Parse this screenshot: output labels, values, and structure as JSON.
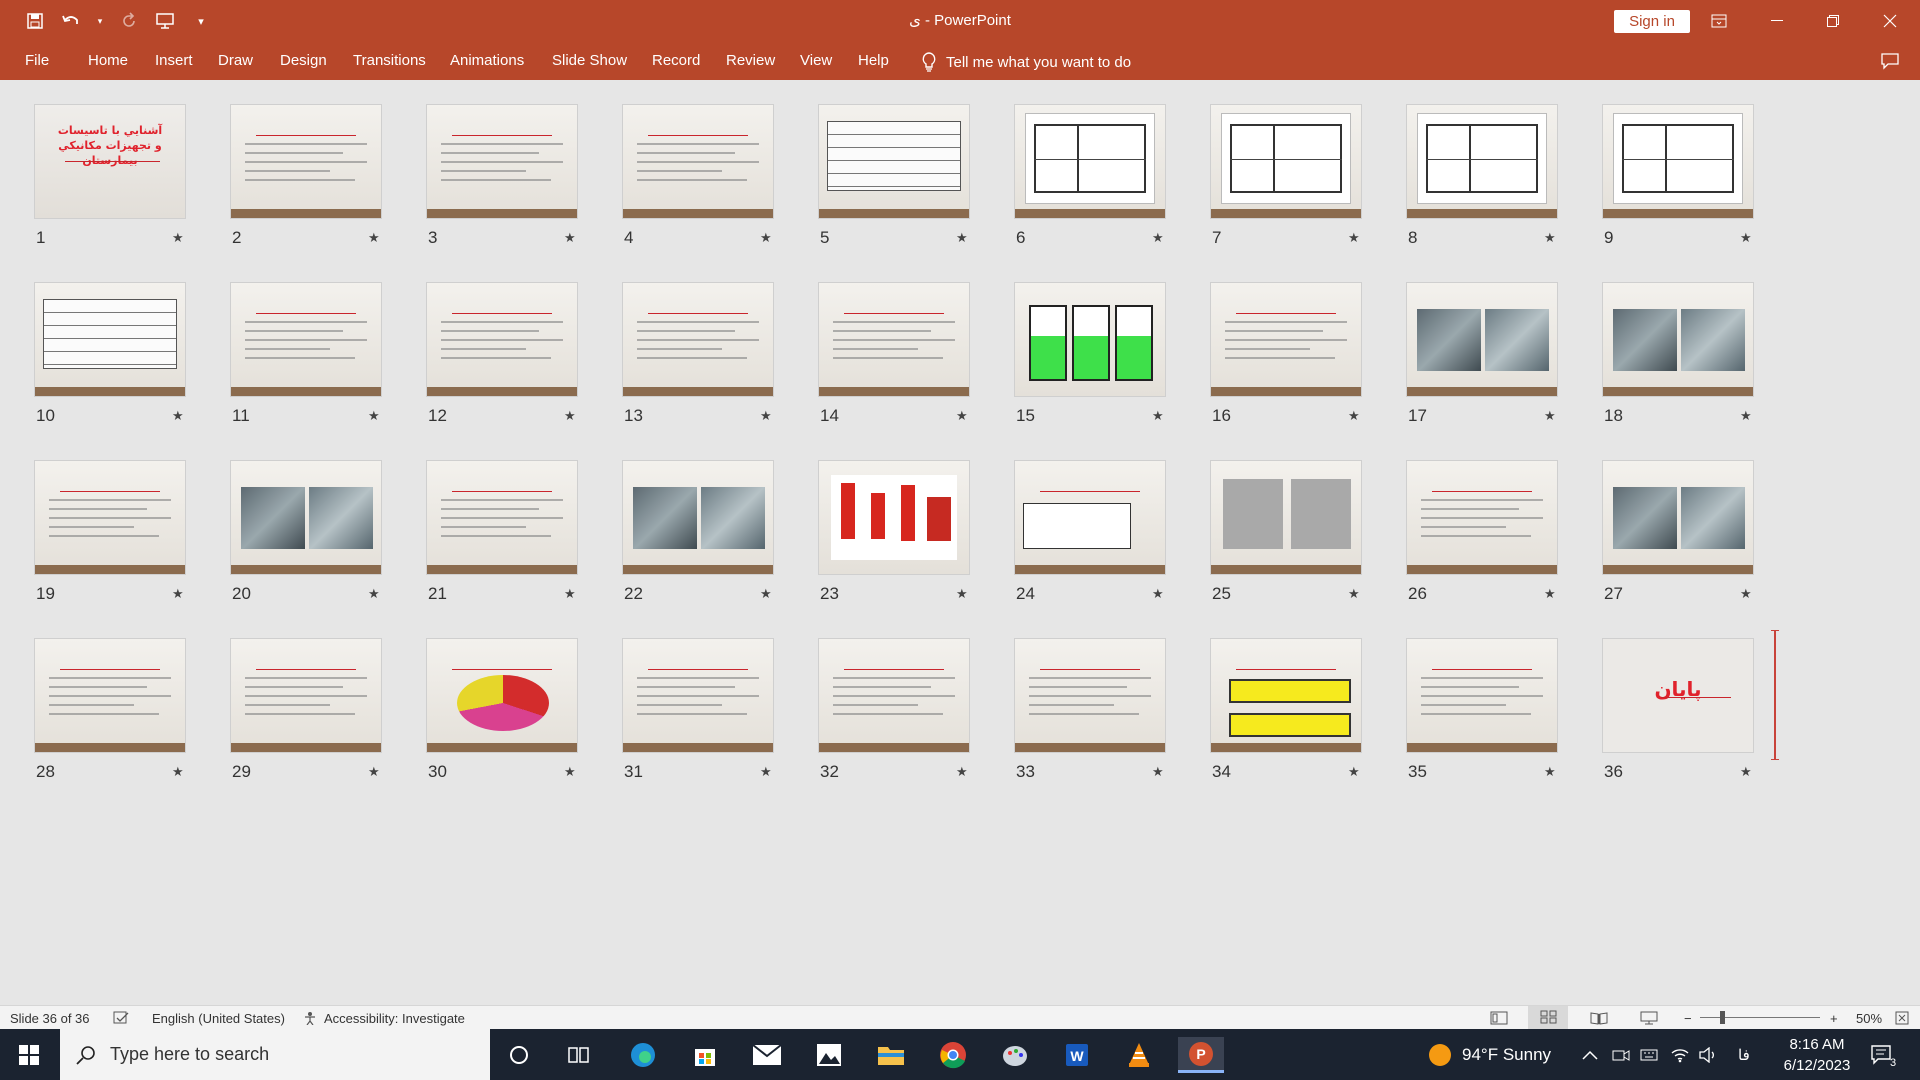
{
  "window": {
    "title": "ی  -  PowerPoint",
    "sign_in": "Sign in"
  },
  "qat": {
    "icons": [
      "save-icon",
      "undo-icon",
      "redo-icon",
      "present-icon",
      "customize-icon"
    ]
  },
  "menu": {
    "items": [
      "File",
      "Home",
      "Insert",
      "Draw",
      "Design",
      "Transitions",
      "Animations",
      "Slide Show",
      "Record",
      "Review",
      "View",
      "Help"
    ],
    "tell_me": "Tell me what you want to do"
  },
  "slides": [
    {
      "number": "1",
      "kind": "title",
      "title": "آشنايي با تاسیسات و تجهیزات مکانیکي بیمارستان"
    },
    {
      "number": "2",
      "kind": "text"
    },
    {
      "number": "3",
      "kind": "text"
    },
    {
      "number": "4",
      "kind": "text"
    },
    {
      "number": "5",
      "kind": "table"
    },
    {
      "number": "6",
      "kind": "plan"
    },
    {
      "number": "7",
      "kind": "plan"
    },
    {
      "number": "8",
      "kind": "plan"
    },
    {
      "number": "9",
      "kind": "plan"
    },
    {
      "number": "10",
      "kind": "table"
    },
    {
      "number": "11",
      "kind": "text"
    },
    {
      "number": "12",
      "kind": "text"
    },
    {
      "number": "13",
      "kind": "text"
    },
    {
      "number": "14",
      "kind": "text"
    },
    {
      "number": "15",
      "kind": "boxes"
    },
    {
      "number": "16",
      "kind": "text"
    },
    {
      "number": "17",
      "kind": "photo"
    },
    {
      "number": "18",
      "kind": "photo"
    },
    {
      "number": "19",
      "kind": "text"
    },
    {
      "number": "20",
      "kind": "photo"
    },
    {
      "number": "21",
      "kind": "text"
    },
    {
      "number": "22",
      "kind": "photo"
    },
    {
      "number": "23",
      "kind": "pumps"
    },
    {
      "number": "24",
      "kind": "diagram"
    },
    {
      "number": "25",
      "kind": "chart"
    },
    {
      "number": "26",
      "kind": "text"
    },
    {
      "number": "27",
      "kind": "photo"
    },
    {
      "number": "28",
      "kind": "text"
    },
    {
      "number": "29",
      "kind": "text"
    },
    {
      "number": "30",
      "kind": "pie"
    },
    {
      "number": "31",
      "kind": "text"
    },
    {
      "number": "32",
      "kind": "text"
    },
    {
      "number": "33",
      "kind": "text"
    },
    {
      "number": "34",
      "kind": "yellow"
    },
    {
      "number": "35",
      "kind": "text"
    },
    {
      "number": "36",
      "kind": "end",
      "title": "پایان"
    }
  ],
  "status": {
    "slide_of": "Slide 36 of 36",
    "language": "English (United States)",
    "accessibility": "Accessibility: Investigate",
    "zoom": "50%"
  },
  "taskbar": {
    "search_placeholder": "Type here to search",
    "apps": [
      "task-view-icon",
      "edge-icon",
      "store-icon",
      "mail-icon",
      "photos-icon",
      "explorer-icon",
      "chrome-icon",
      "paint-icon",
      "word-icon",
      "vlc-icon",
      "powerpoint-icon"
    ],
    "weather": "94°F  Sunny",
    "lang": "فا",
    "time": "8:16 AM",
    "date": "6/12/2023",
    "notif_count": "3"
  }
}
